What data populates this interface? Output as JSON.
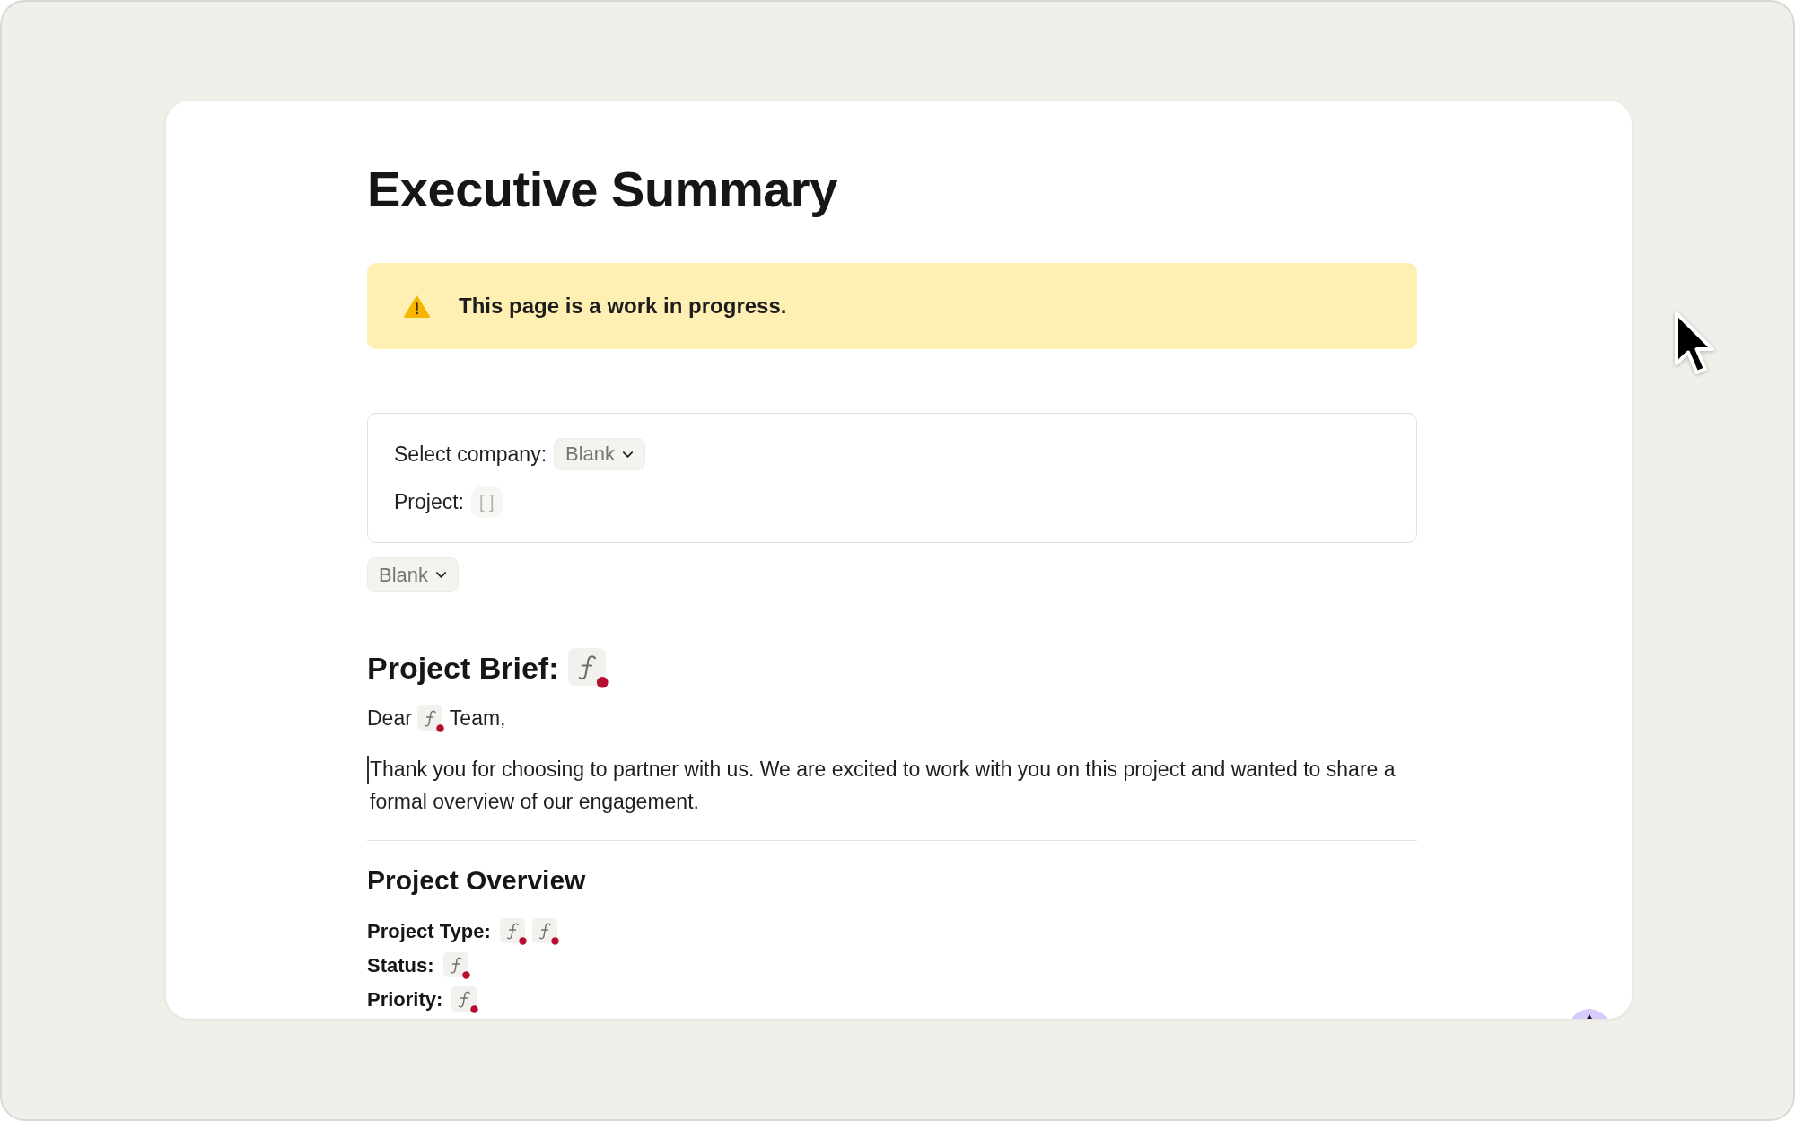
{
  "page": {
    "title": "Executive Summary"
  },
  "callout": {
    "kind": "warning",
    "text": "This page is a work in progress."
  },
  "form": {
    "fields": [
      {
        "kind": "dropdown",
        "label": "Select company:",
        "value": "Blank"
      },
      {
        "kind": "formula",
        "label": "Project:",
        "value": "[ ]"
      }
    ]
  },
  "dropdown": {
    "value": "Blank"
  },
  "brief": {
    "heading": "Project Brief:",
    "heading_formulas": [
      {
        "error": true
      }
    ],
    "greeting": {
      "before": "Dear",
      "formulas": [
        {
          "error": true
        }
      ],
      "after": "Team,"
    },
    "body": {
      "text": "Thank you for choosing to partner with us. We are excited to work with you on this project and wanted to share a formal overview of our engagement.",
      "caret": true
    }
  },
  "overview": {
    "heading": "Project Overview",
    "rows": [
      {
        "label": "Project Type:",
        "formulas": [
          {
            "error": true
          },
          {
            "error": true
          }
        ]
      },
      {
        "label": "Status:",
        "formulas": [
          {
            "error": true
          }
        ]
      },
      {
        "label": "Priority:",
        "formulas": [
          {
            "error": true
          }
        ]
      }
    ]
  }
}
